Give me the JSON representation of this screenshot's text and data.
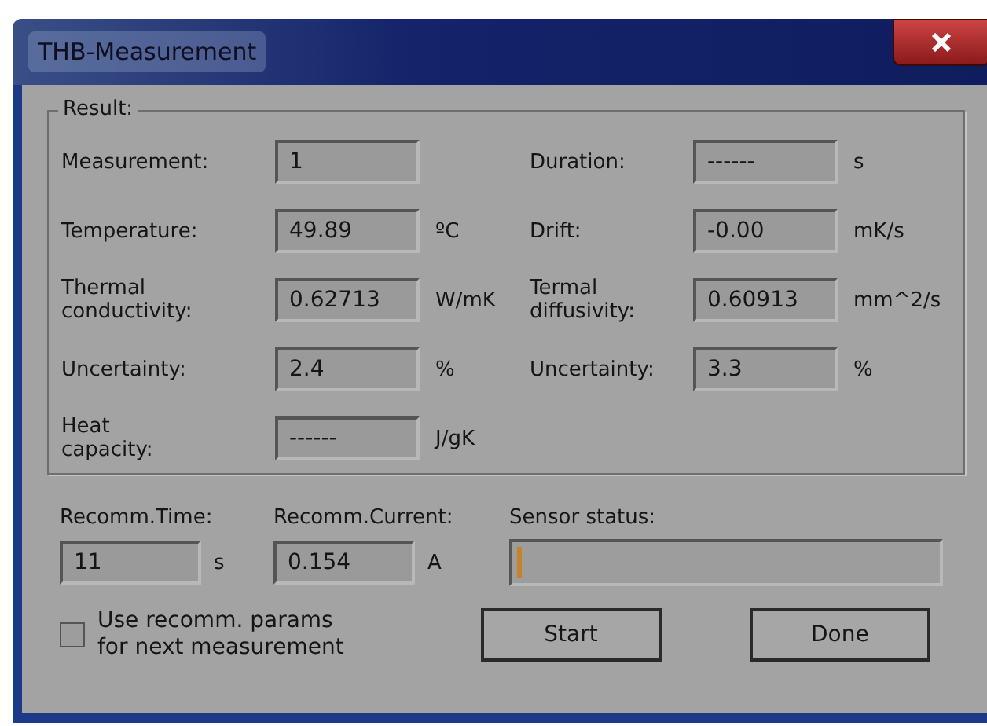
{
  "window": {
    "title": "THB-Measurement"
  },
  "result": {
    "title": "Result:",
    "rows": [
      {
        "left": {
          "label": "Measurement:",
          "value": "1"
        },
        "right": {
          "label": "Duration:",
          "value": "------",
          "unit": "s"
        }
      },
      {
        "left": {
          "label": "Temperature:",
          "value": "49.89",
          "unit": "ºC"
        },
        "right": {
          "label": "Drift:",
          "value": "-0.00",
          "unit": "mK/s"
        }
      },
      {
        "left": {
          "label": "Thermal\nconductivity:",
          "value": "0.62713",
          "unit": "W/mK"
        },
        "right": {
          "label": "Termal\ndiffusivity:",
          "value": "0.60913",
          "unit": "mm^2/s"
        }
      },
      {
        "left": {
          "label": "Uncertainty:",
          "value": "2.4",
          "unit": "%"
        },
        "right": {
          "label": "Uncertainty:",
          "value": "3.3",
          "unit": "%"
        }
      },
      {
        "left": {
          "label": "Heat\ncapacity:",
          "value": "------",
          "unit": "J/gK"
        }
      }
    ]
  },
  "recommended": [
    {
      "label": "Recomm.Time:",
      "value": "11",
      "unit": "s"
    },
    {
      "label": "Recomm.Current:",
      "value": "0.154",
      "unit": "A"
    }
  ],
  "sensor_status": {
    "label": "Sensor status:",
    "level": 0.01
  },
  "checkbox": {
    "label": "Use recomm. params\nfor next measurement",
    "checked": false
  },
  "buttons": [
    "Start",
    "Done"
  ]
}
